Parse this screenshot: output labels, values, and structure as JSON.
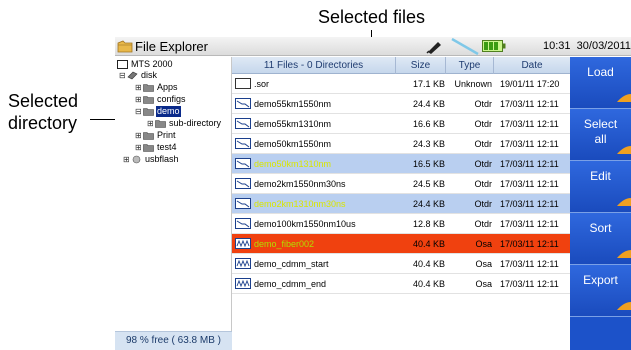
{
  "annotations": {
    "selected_files": "Selected files",
    "selected_directory_line1": "Selected",
    "selected_directory_line2": "directory"
  },
  "titlebar": {
    "title": "File Explorer",
    "time": "10:31",
    "date": "30/03/2011",
    "icons": [
      "folder-app-icon",
      "pen-icon",
      "signal-icon",
      "battery-icon"
    ]
  },
  "tree": {
    "items": [
      {
        "label": "MTS 2000",
        "icon": "device-icon",
        "expander": ""
      },
      {
        "label": "disk",
        "icon": "disk-icon",
        "expander": "⊟"
      },
      {
        "label": "Apps",
        "icon": "folder-icon",
        "expander": "⊞"
      },
      {
        "label": "configs",
        "icon": "folder-icon",
        "expander": "⊞"
      },
      {
        "label": "demo",
        "icon": "folder-icon",
        "expander": "⊟",
        "selected": true
      },
      {
        "label": "sub-directory",
        "icon": "folder-icon",
        "expander": "⊞"
      },
      {
        "label": "Print",
        "icon": "folder-icon",
        "expander": "⊞"
      },
      {
        "label": "test4",
        "icon": "folder-icon",
        "expander": "⊞"
      },
      {
        "label": "usbflash",
        "icon": "usb-icon",
        "expander": "⊞"
      }
    ],
    "footer": "98 % free ( 63.8 MB )"
  },
  "table": {
    "headers": {
      "name": "11 Files - 0 Directories",
      "size": "Size",
      "type": "Type",
      "date": "Date"
    },
    "rows": [
      {
        "name": ".sor",
        "size": "17.1 KB",
        "type": "Unknown",
        "date": "19/01/11 17:20",
        "icon": "blank-file-icon",
        "state": "normal"
      },
      {
        "name": "demo55km1550nm",
        "size": "24.4 KB",
        "type": "Otdr",
        "date": "17/03/11 12:11",
        "icon": "otdr-file-icon",
        "state": "normal"
      },
      {
        "name": "demo55km1310nm",
        "size": "16.6 KB",
        "type": "Otdr",
        "date": "17/03/11 12:11",
        "icon": "otdr-file-icon",
        "state": "normal"
      },
      {
        "name": "demo50km1550nm",
        "size": "24.3 KB",
        "type": "Otdr",
        "date": "17/03/11 12:11",
        "icon": "otdr-file-icon",
        "state": "normal"
      },
      {
        "name": "demo50km1310nm",
        "size": "16.5 KB",
        "type": "Otdr",
        "date": "17/03/11 12:11",
        "icon": "otdr-file-icon",
        "state": "selected"
      },
      {
        "name": "demo2km1550nm30ns",
        "size": "24.5 KB",
        "type": "Otdr",
        "date": "17/03/11 12:11",
        "icon": "otdr-file-icon",
        "state": "normal"
      },
      {
        "name": "demo2km1310nm30ns",
        "size": "24.4 KB",
        "type": "Otdr",
        "date": "17/03/11 12:11",
        "icon": "otdr-file-icon",
        "state": "selected"
      },
      {
        "name": "demo100km1550nm10us",
        "size": "12.8 KB",
        "type": "Otdr",
        "date": "17/03/11 12:11",
        "icon": "otdr-file-icon",
        "state": "normal"
      },
      {
        "name": "demo_fiber002",
        "size": "40.4 KB",
        "type": "Osa",
        "date": "17/03/11 12:11",
        "icon": "osa-file-icon",
        "state": "current"
      },
      {
        "name": "demo_cdmm_start",
        "size": "40.4 KB",
        "type": "Osa",
        "date": "17/03/11 12:11",
        "icon": "osa-file-icon",
        "state": "normal"
      },
      {
        "name": "demo_cdmm_end",
        "size": "40.4 KB",
        "type": "Osa",
        "date": "17/03/11 12:11",
        "icon": "osa-file-icon",
        "state": "normal"
      }
    ]
  },
  "side_buttons": [
    {
      "line1": "Load",
      "line2": ""
    },
    {
      "line1": "Select",
      "line2": "all"
    },
    {
      "line1": "Edit",
      "line2": ""
    },
    {
      "line1": "Sort",
      "line2": ""
    },
    {
      "line1": "Export",
      "line2": ""
    }
  ],
  "colors": {
    "side_bar": "#1c52c9",
    "selected_row": "#b9cff0",
    "current_row": "#f0410f",
    "selected_dir": "#0a2a8a"
  }
}
